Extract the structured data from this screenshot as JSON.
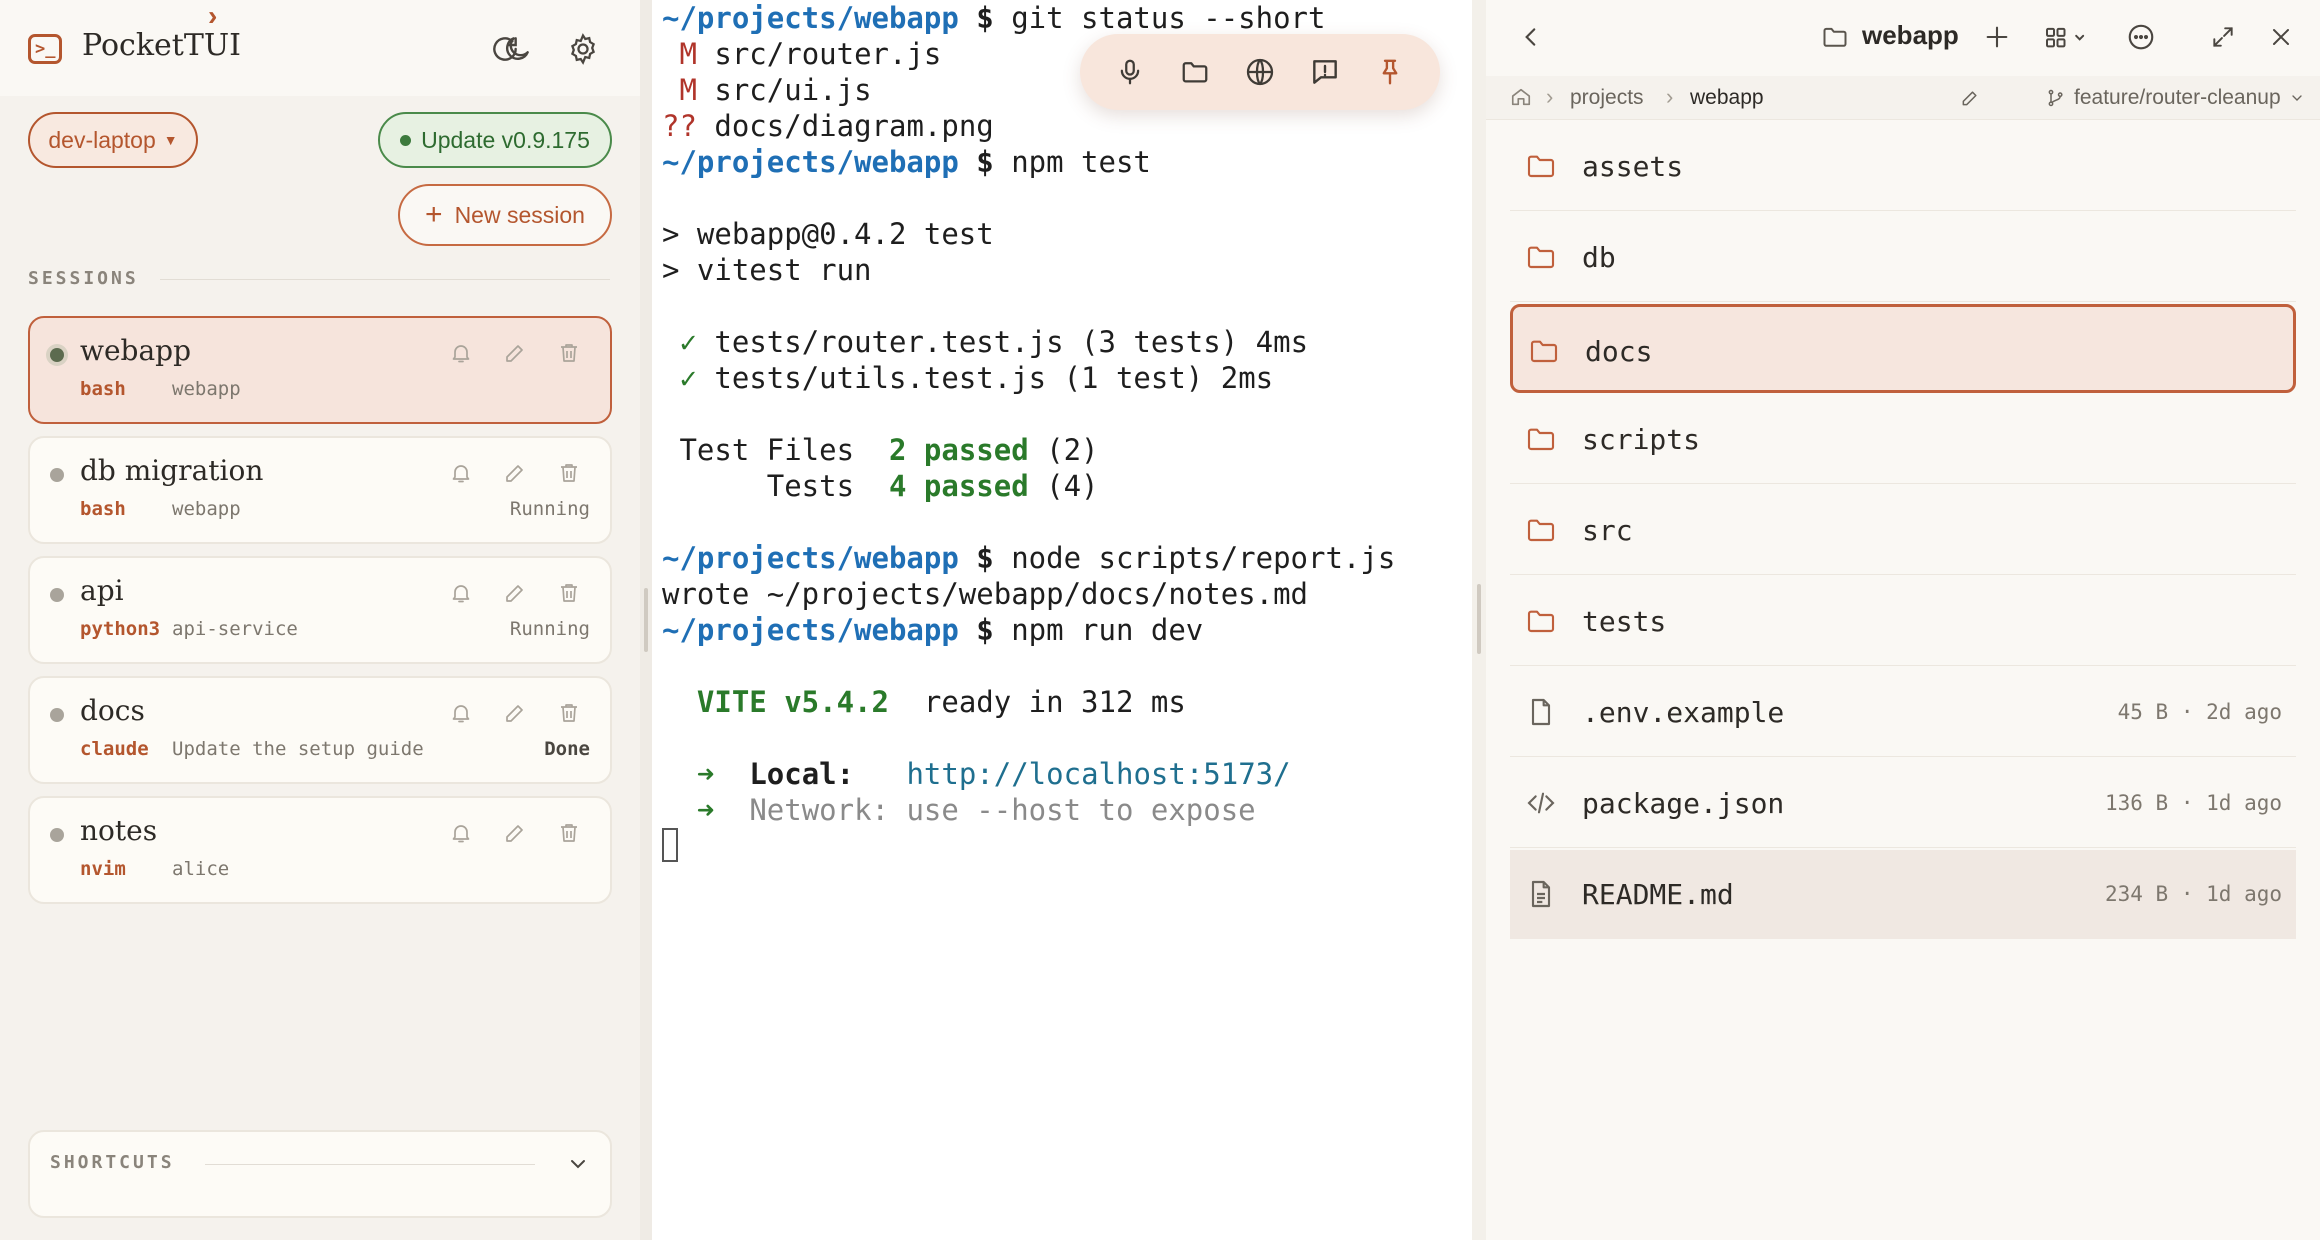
{
  "app": {
    "title": "PocketTUI"
  },
  "sidebar": {
    "host": "dev-laptop",
    "update_label": "Update v0.9.175",
    "new_session_label": "New session",
    "sessions_heading": "SESSIONS",
    "sessions": [
      {
        "name": "webapp",
        "type": "bash",
        "detail": "webapp",
        "status": "",
        "active": true
      },
      {
        "name": "db migration",
        "type": "bash",
        "detail": "webapp",
        "status": "Running"
      },
      {
        "name": "api",
        "type": "python3",
        "detail": "api-service",
        "status": "Running"
      },
      {
        "name": "docs",
        "type": "claude",
        "detail": "Update the setup guide",
        "status": "Done"
      },
      {
        "name": "notes",
        "type": "nvim",
        "detail": "alice",
        "status": ""
      }
    ],
    "shortcuts_label": "SHORTCUTS"
  },
  "terminal": {
    "lines": [
      {
        "type": "prompt",
        "path": "~/projects/webapp",
        "cmd": "git status --short"
      },
      {
        "type": "status",
        "code": " M",
        "text": "src/router.js"
      },
      {
        "type": "status",
        "code": " M",
        "text": "src/ui.js"
      },
      {
        "type": "status",
        "code": "??",
        "text": "docs/diagram.png"
      },
      {
        "type": "prompt",
        "path": "~/projects/webapp",
        "cmd": "npm test"
      },
      {
        "type": "blank"
      },
      {
        "type": "plain",
        "text": "> webapp@0.4.2 test"
      },
      {
        "type": "plain",
        "text": "> vitest run"
      },
      {
        "type": "blank"
      },
      {
        "type": "check",
        "text": "tests/router.test.js (3 tests) 4ms"
      },
      {
        "type": "check",
        "text": "tests/utils.test.js (1 test) 2ms"
      },
      {
        "type": "blank"
      },
      {
        "type": "summary",
        "label": " Test Files",
        "count": "2 passed",
        "total": "(2)"
      },
      {
        "type": "summary",
        "label": "      Tests",
        "count": "4 passed",
        "total": "(4)"
      },
      {
        "type": "blank"
      },
      {
        "type": "prompt",
        "path": "~/projects/webapp",
        "cmd": "node scripts/report.js"
      },
      {
        "type": "plain",
        "text": "wrote ~/projects/webapp/docs/notes.md"
      },
      {
        "type": "prompt",
        "path": "~/projects/webapp",
        "cmd": "npm run dev"
      },
      {
        "type": "blank"
      },
      {
        "type": "vite",
        "name": "VITE v5.4.2",
        "text": "ready in 312 ms"
      },
      {
        "type": "blank"
      },
      {
        "type": "local",
        "label": "Local:",
        "url": "http://localhost:5173/"
      },
      {
        "type": "network",
        "text": "Network: use --host to expose"
      }
    ]
  },
  "toolbar": {
    "icons": [
      "mic-icon",
      "folder-icon",
      "globe-icon",
      "feedback-icon",
      "pin-icon"
    ]
  },
  "files": {
    "title": "webapp",
    "breadcrumbs": [
      "projects",
      "webapp"
    ],
    "branch": "feature/router-cleanup",
    "items": [
      {
        "name": "assets",
        "kind": "folder",
        "size": "",
        "age": ""
      },
      {
        "name": "db",
        "kind": "folder",
        "size": "",
        "age": ""
      },
      {
        "name": "docs",
        "kind": "folder",
        "size": "",
        "age": "",
        "selected": true
      },
      {
        "name": "scripts",
        "kind": "folder",
        "size": "",
        "age": ""
      },
      {
        "name": "src",
        "kind": "folder",
        "size": "",
        "age": ""
      },
      {
        "name": "tests",
        "kind": "folder",
        "size": "",
        "age": ""
      },
      {
        "name": ".env.example",
        "kind": "file",
        "size": "45 B",
        "age": "2d ago"
      },
      {
        "name": "package.json",
        "kind": "code",
        "size": "136 B",
        "age": "1d ago"
      },
      {
        "name": "README.md",
        "kind": "doc",
        "size": "234 B",
        "age": "1d ago",
        "hover": true
      }
    ]
  },
  "colors": {
    "accent": "#b4562e",
    "success": "#2e6b30",
    "link": "#1f6fb5"
  }
}
